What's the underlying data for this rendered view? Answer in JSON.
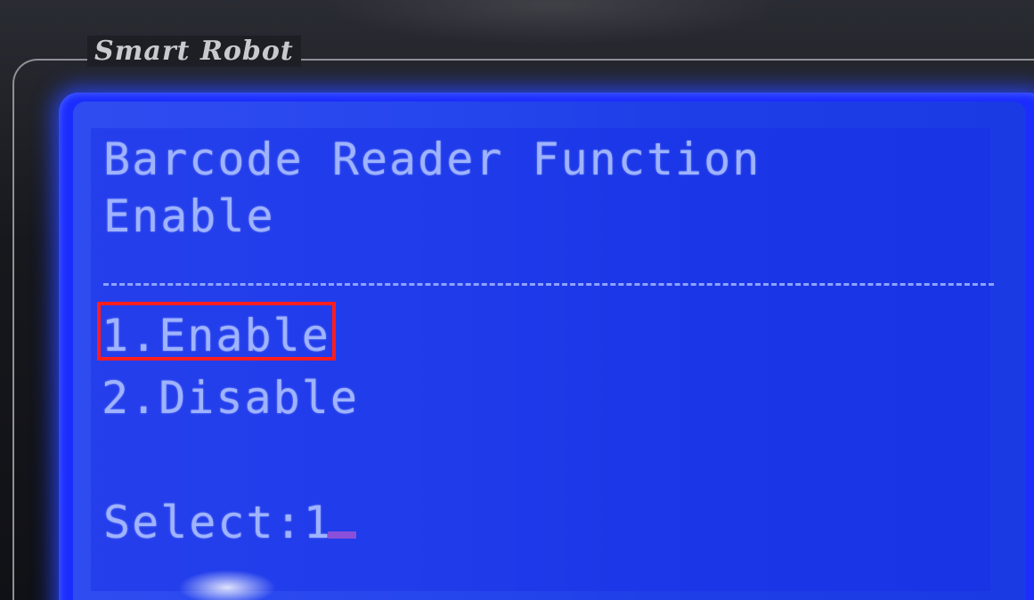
{
  "device": {
    "brand": "Smart Robot"
  },
  "screen": {
    "title_line1": "Barcode Reader Function",
    "title_line2": "Enable",
    "options": [
      {
        "label": "1.Enable",
        "highlighted": true
      },
      {
        "label": "2.Disable",
        "highlighted": false
      }
    ],
    "select_line": "Select:1",
    "colors": {
      "lcd_background": "#2747ee",
      "lcd_text": "#9fb3ff",
      "highlight_border": "#ff1e1e",
      "cursor": "#8a4fd8"
    }
  }
}
